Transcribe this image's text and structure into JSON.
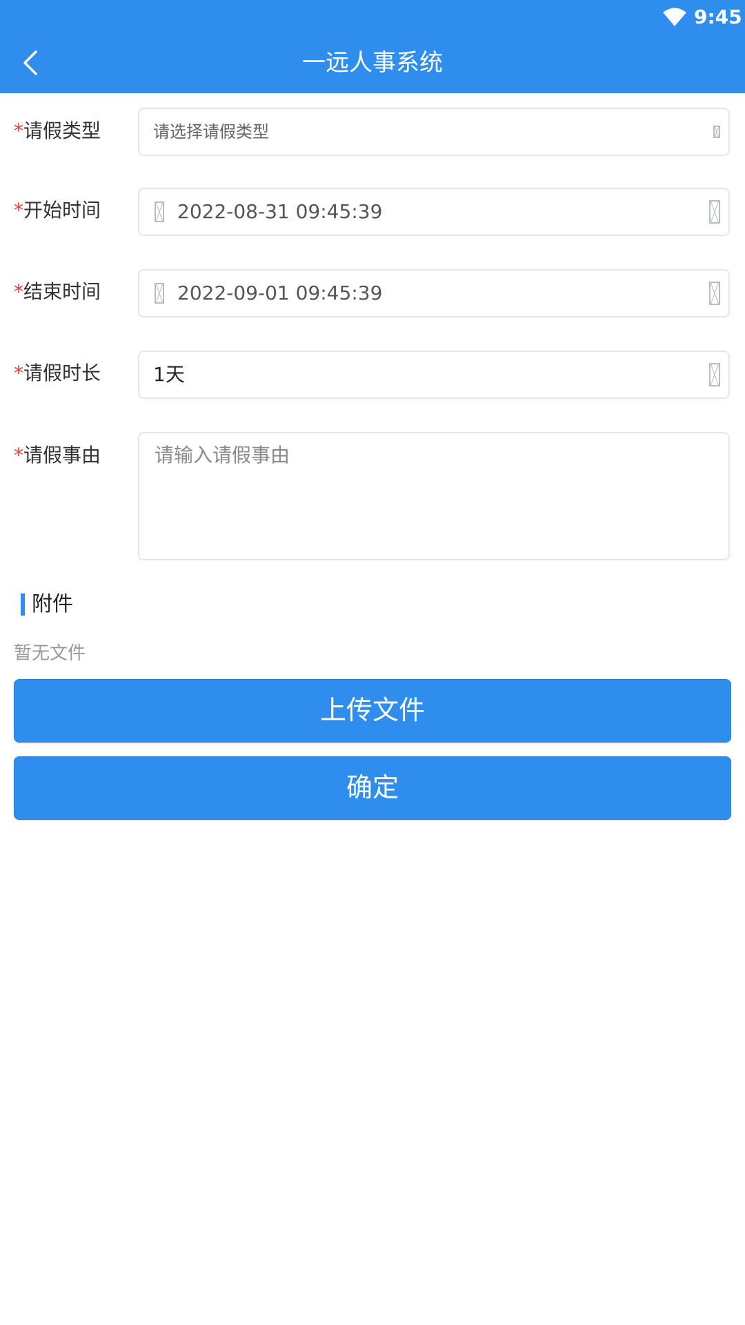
{
  "status_bar": {
    "time": "9:45",
    "wifi_icon": "wifi-icon"
  },
  "header": {
    "title": "一远人事系统",
    "back_icon": "chevron-left-icon"
  },
  "colors": {
    "primary": "#2e8ded",
    "required": "#e53935"
  },
  "form": {
    "required_mark": "*",
    "leave_type": {
      "label": "请假类型",
      "placeholder": "请选择请假类型"
    },
    "start_time": {
      "label": "开始时间",
      "value": "2022-08-31 09:45:39"
    },
    "end_time": {
      "label": "结束时间",
      "value": "2022-09-01 09:45:39"
    },
    "duration": {
      "label": "请假时长",
      "value": "1天"
    },
    "reason": {
      "label": "请假事由",
      "placeholder": "请输入请假事由"
    }
  },
  "attachments": {
    "title": "附件",
    "empty_text": "暂无文件"
  },
  "buttons": {
    "upload_label": "上传文件",
    "confirm_label": "确定"
  }
}
